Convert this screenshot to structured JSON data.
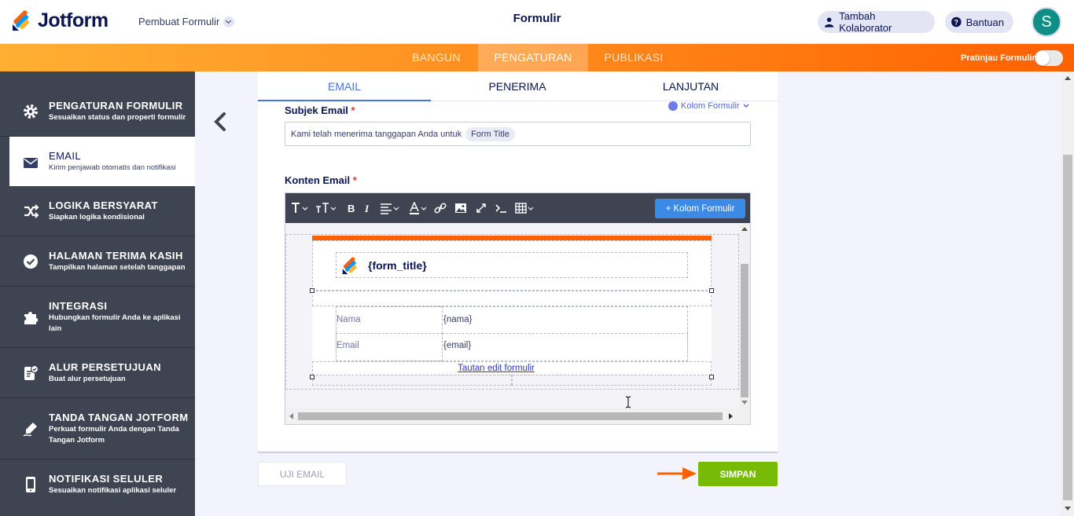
{
  "header": {
    "brand": "Jotform",
    "builder_label": "Pembuat Formulir",
    "title": "Formulir",
    "collaborator_label": "Tambah Kolaborator",
    "help_label": "Bantuan",
    "avatar_initial": "S",
    "avatar_color": "#0f8e85"
  },
  "nav": {
    "tabs": [
      "BANGUN",
      "PENGATURAN",
      "PUBLIKASI"
    ],
    "active_tab": "PENGATURAN",
    "preview_label": "Pratinjau Formulir",
    "accent_color": "#ff6100"
  },
  "sidebar": {
    "items": [
      {
        "title": "PENGATURAN FORMULIR",
        "desc": "Sesuaikan status dan properti formulir",
        "icon": "gear-icon"
      },
      {
        "title": "EMAIL",
        "desc": "Kirim penjawab otomatis dan notifikasi",
        "icon": "envelope-icon"
      },
      {
        "title": "LOGIKA BERSYARAT",
        "desc": "Siapkan logika kondisional",
        "icon": "shuffle-icon"
      },
      {
        "title": "HALAMAN TERIMA KASIH",
        "desc": "Tampilkan halaman setelah tanggapan",
        "icon": "check-circle-icon"
      },
      {
        "title": "INTEGRASI",
        "desc": "Hubungkan formulir Anda ke aplikasi lain",
        "icon": "puzzle-icon"
      },
      {
        "title": "ALUR PERSETUJUAN",
        "desc": "Buat alur persetujuan",
        "icon": "approval-icon"
      },
      {
        "title": "TANDA TANGAN JOTFORM",
        "desc": "Perkuat formulir Anda dengan Tanda Tangan Jotform",
        "icon": "pen-icon"
      },
      {
        "title": "NOTIFIKASI SELULER",
        "desc": "Sesuaikan notifikasi aplikasi seluler",
        "icon": "mobile-icon"
      }
    ]
  },
  "email_tabs": [
    "EMAIL",
    "PENERIMA",
    "LANJUTAN"
  ],
  "subject": {
    "label": "Subjek Email",
    "required_mark": "*",
    "field_link": "Kolom Formulir",
    "text": "Kami telah menerima tanggapan Anda untuk",
    "tag": "Form Title"
  },
  "content": {
    "label": "Konten Email",
    "required_mark": "*",
    "add_field_button": "+ Kolom Formulir",
    "form_title_token": "{form_title}",
    "rows": [
      {
        "label": "Nama",
        "value": "{nama}"
      },
      {
        "label": "Email",
        "value": "{email}"
      }
    ],
    "edit_link": "Tautan edit formulir"
  },
  "footer": {
    "test_button": "UJI EMAIL",
    "save_button": "SIMPAN",
    "save_color": "#78bb07"
  }
}
